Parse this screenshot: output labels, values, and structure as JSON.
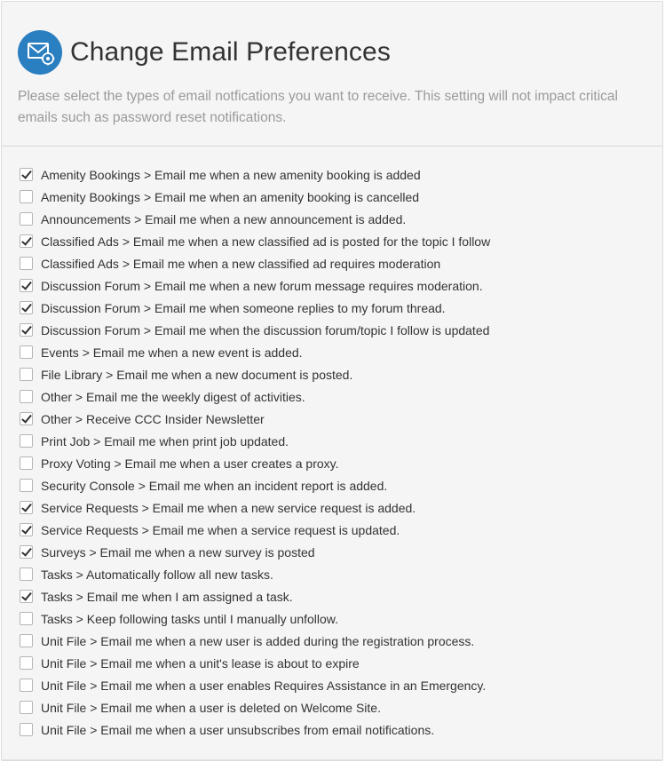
{
  "header": {
    "icon": "email-settings-icon",
    "title": "Change Email Preferences",
    "subtitle": "Please select the types of email notfications you want to receive. This setting will not impact critical emails such as password reset notifications."
  },
  "colors": {
    "accent": "#2a7fc1",
    "panel_bg": "#f5f5f5",
    "subtitle": "#9a9a9a"
  },
  "preferences": [
    {
      "label": "Amenity Bookings > Email me when a new amenity booking is added",
      "checked": true
    },
    {
      "label": "Amenity Bookings > Email me when an amenity booking is cancelled",
      "checked": false
    },
    {
      "label": "Announcements > Email me when a new announcement is added.",
      "checked": false
    },
    {
      "label": "Classified Ads > Email me when a new classified ad is posted for the topic I follow",
      "checked": true
    },
    {
      "label": "Classified Ads > Email me when a new classified ad requires moderation",
      "checked": false
    },
    {
      "label": "Discussion Forum > Email me when a new forum message requires moderation.",
      "checked": true
    },
    {
      "label": "Discussion Forum > Email me when someone replies to my forum thread.",
      "checked": true
    },
    {
      "label": "Discussion Forum > Email me when the discussion forum/topic I follow is updated",
      "checked": true
    },
    {
      "label": "Events > Email me when a new event is added.",
      "checked": false
    },
    {
      "label": "File Library > Email me when a new document is posted.",
      "checked": false
    },
    {
      "label": "Other > Email me the weekly digest of activities.",
      "checked": false
    },
    {
      "label": "Other > Receive CCC Insider Newsletter",
      "checked": true
    },
    {
      "label": "Print Job > Email me when print job updated.",
      "checked": false
    },
    {
      "label": "Proxy Voting > Email me when a user creates a proxy.",
      "checked": false
    },
    {
      "label": "Security Console > Email me when an incident report is added.",
      "checked": false
    },
    {
      "label": "Service Requests > Email me when a new service request is added.",
      "checked": true
    },
    {
      "label": "Service Requests > Email me when a service request is updated.",
      "checked": true
    },
    {
      "label": "Surveys > Email me when a new survey is posted",
      "checked": true
    },
    {
      "label": "Tasks > Automatically follow all new tasks.",
      "checked": false
    },
    {
      "label": "Tasks > Email me when I am assigned a task.",
      "checked": true
    },
    {
      "label": "Tasks > Keep following tasks until I manually unfollow.",
      "checked": false
    },
    {
      "label": "Unit File > Email me when a new user is added during the registration process.",
      "checked": false
    },
    {
      "label": "Unit File > Email me when a unit's lease is about to expire",
      "checked": false
    },
    {
      "label": "Unit File > Email me when a user enables Requires Assistance in an Emergency.",
      "checked": false
    },
    {
      "label": "Unit File > Email me when a user is deleted on Welcome Site.",
      "checked": false
    },
    {
      "label": "Unit File > Email me when a user unsubscribes from email notifications.",
      "checked": false
    }
  ]
}
